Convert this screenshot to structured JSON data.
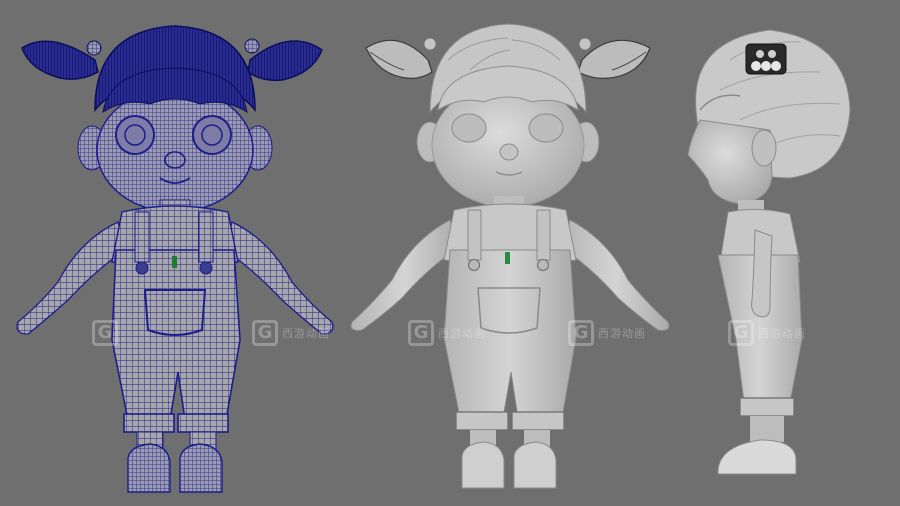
{
  "scene": {
    "background": "#6f6f6f",
    "views": [
      {
        "id": "front-wireframe",
        "wire_color": "#1c1e8a",
        "shade": "#a9a9a9"
      },
      {
        "id": "front-shaded",
        "shade": "#c8c8c8"
      },
      {
        "id": "side-shaded",
        "shade": "#c8c8c8"
      }
    ]
  },
  "watermark": {
    "logo_letter": "G",
    "text": "西游动画"
  }
}
